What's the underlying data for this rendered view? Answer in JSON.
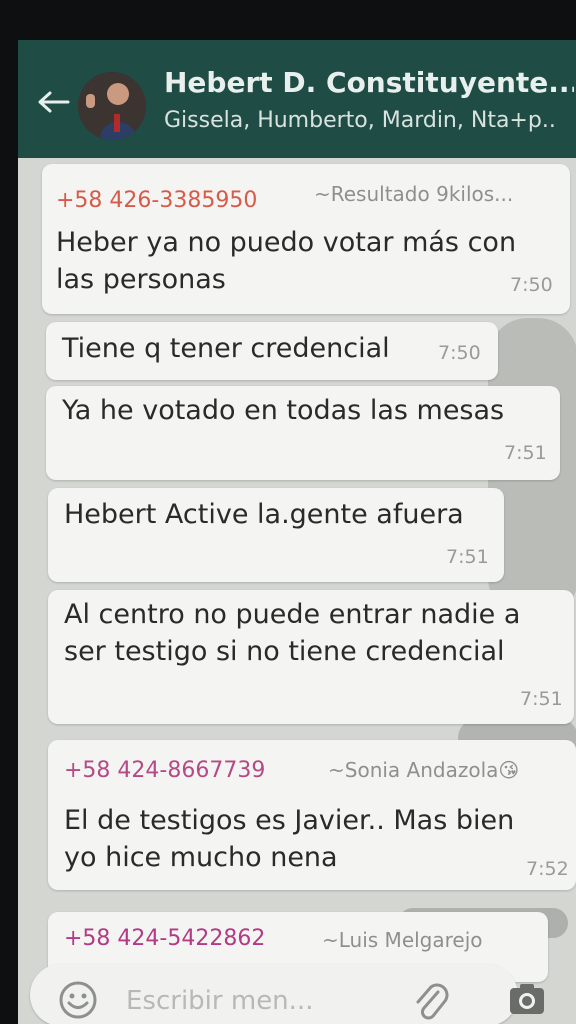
{
  "header": {
    "title": "Hebert D. Constituyente...",
    "subtitle": "Gissela, Humberto, Mardin, Nta+p..",
    "back_icon": "arrow-left-icon",
    "avatar": "group-avatar"
  },
  "messages": [
    {
      "sender": "+58 426-3385950",
      "alias": "~Resultado 9kilos...",
      "lines": [
        "Heber ya no puedo votar más con",
        "las personas"
      ],
      "time": "7:50"
    },
    {
      "text": "Tiene q tener credencial",
      "time": "7:50"
    },
    {
      "text": "Ya he votado en todas las mesas",
      "time": "7:51"
    },
    {
      "text": "Hebert Active la.gente afuera",
      "time": "7:51"
    },
    {
      "lines": [
        "Al centro no puede entrar nadie a",
        "ser testigo si no tiene credencial"
      ],
      "time": "7:51"
    },
    {
      "sender": "+58 424-8667739",
      "alias": "~Sonia Andazola",
      "alias_emoji": "😘",
      "lines": [
        "El de testigos es Javier.. Mas bien",
        "yo hice mucho nena"
      ],
      "time": "7:52"
    },
    {
      "sender": "+58 424-5422862",
      "alias": "~Luis Melgarejo"
    }
  ],
  "composer": {
    "placeholder": "Escribir men...",
    "emoji_icon": "emoji-icon",
    "attach_icon": "paperclip-icon",
    "camera_icon": "camera-icon"
  },
  "colors": {
    "header": "#1f4d46",
    "sender_orange": "#d85a48",
    "sender_purple": "#b54a86",
    "bubble": "#f4f5f3"
  }
}
